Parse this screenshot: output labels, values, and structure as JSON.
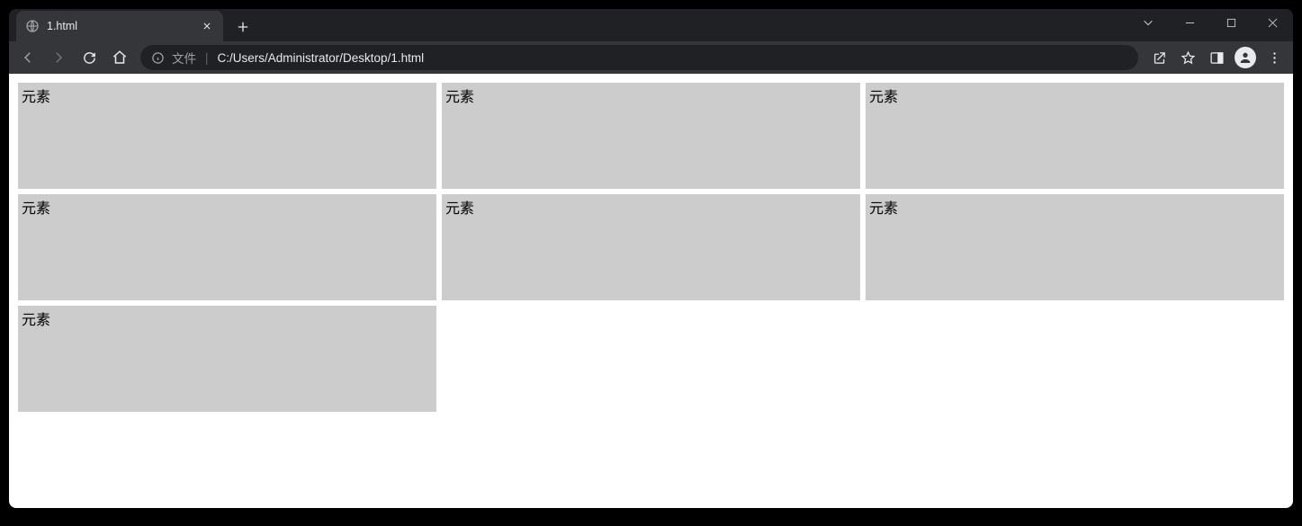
{
  "browser": {
    "tab_title": "1.html",
    "address_label": "文件",
    "url": "C:/Users/Administrator/Desktop/1.html"
  },
  "page": {
    "cells": [
      {
        "label": "元素"
      },
      {
        "label": "元素"
      },
      {
        "label": "元素"
      },
      {
        "label": "元素"
      },
      {
        "label": "元素"
      },
      {
        "label": "元素"
      },
      {
        "label": "元素"
      }
    ]
  }
}
